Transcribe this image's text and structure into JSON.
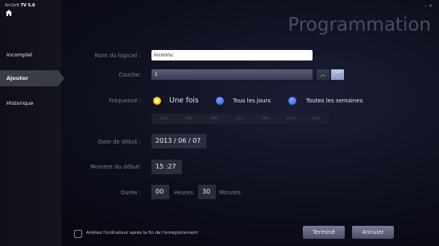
{
  "app": {
    "name_prefix": "ArcSoft",
    "name": "TV 5.0"
  },
  "title": "Programmation",
  "sidebar": {
    "items": [
      {
        "label": "Incomplet"
      },
      {
        "label": "Ajouter"
      },
      {
        "label": "Historique"
      }
    ]
  },
  "form": {
    "software_name_label": "Nom du logiciel :",
    "software_name_value": "inconnu",
    "layer_label": "Couche:",
    "layer_value": "1",
    "frequency_label": "Fréquence :",
    "frequency_options": [
      "Une fois",
      "Tous les jours",
      "Toutes les semaines"
    ],
    "frequency_selected": "Une fois",
    "days": [
      "Lun",
      "Mar",
      "Mer",
      "Jeu",
      "Ven",
      "Sam",
      "Dim"
    ],
    "start_date_label": "Date de début :",
    "start_date_value": "2013 / 06 / 07",
    "start_time_label": "Moment du début:",
    "start_time_value": "15 :27",
    "duration_label": "Durée :",
    "duration_hours": "00",
    "hours_label": "Heures",
    "duration_minutes": "30",
    "minutes_label": "Minutes"
  },
  "footer": {
    "shutdown_checkbox_label": "Arrêtez l'ordinateur après la fin de l'enregistrement",
    "done_button": "Terminé",
    "cancel_button": "Annuler"
  },
  "colors": {
    "accent_yellow": "#ffd21e",
    "radio_blue": "#2a56d8",
    "title_color": "#4a4c60"
  }
}
